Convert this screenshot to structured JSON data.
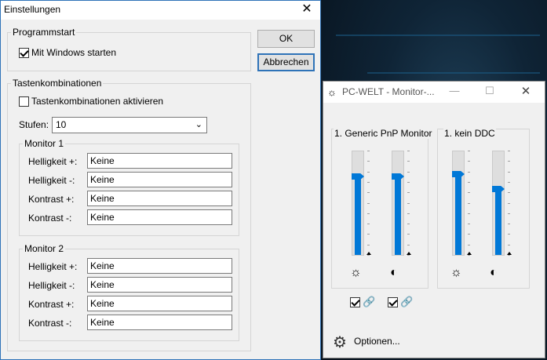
{
  "settings_dialog": {
    "title": "Einstellungen",
    "close_icon": "close-icon",
    "ok_label": "OK",
    "cancel_label": "Abbrechen",
    "programmstart": {
      "label": "Programmstart",
      "autostart_label": "Mit Windows starten",
      "autostart_checked": true
    },
    "hotkeys": {
      "label": "Tastenkombinationen",
      "enable_label": "Tastenkombinationen aktivieren",
      "enable_checked": false,
      "steps_label": "Stufen:",
      "steps_value": "10",
      "monitor1": {
        "label": "Monitor 1",
        "rows": [
          {
            "label": "Helligkeit +:",
            "value": "Keine"
          },
          {
            "label": "Helligkeit -:",
            "value": "Keine"
          },
          {
            "label": "Kontrast +:",
            "value": "Keine"
          },
          {
            "label": "Kontrast -:",
            "value": "Keine"
          }
        ]
      },
      "monitor2": {
        "label": "Monitor 2",
        "rows": [
          {
            "label": "Helligkeit +:",
            "value": "Keine"
          },
          {
            "label": "Helligkeit -:",
            "value": "Keine"
          },
          {
            "label": "Kontrast +:",
            "value": "Keine"
          },
          {
            "label": "Kontrast -:",
            "value": "Keine"
          }
        ]
      }
    }
  },
  "monitor_widget": {
    "title": "PC-WELT - Monitor-...",
    "monitors": [
      {
        "name": "1. Generic PnP Monitor",
        "brightness_level": 0.76,
        "contrast_level": 0.76,
        "brightness_link_checked": true,
        "contrast_link_checked": true
      },
      {
        "name": "1. kein DDC",
        "brightness_level": 0.78,
        "contrast_level": 0.64
      }
    ],
    "options_label": "Optionen...",
    "accent_color": "#0078d7"
  }
}
